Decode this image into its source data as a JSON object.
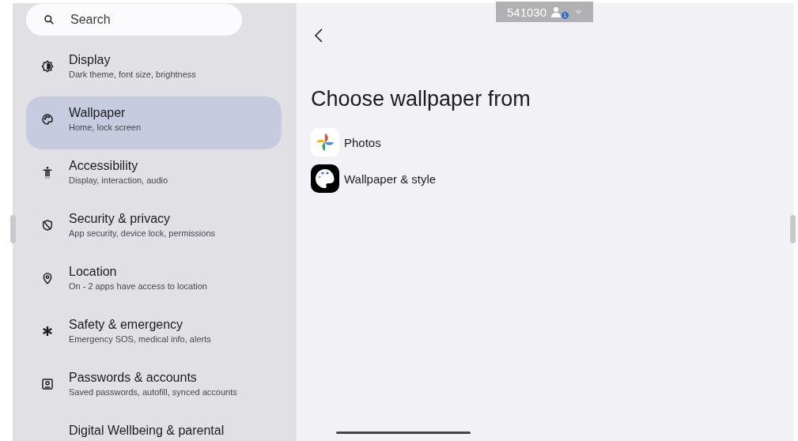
{
  "search": {
    "placeholder": "Search"
  },
  "sidebar": {
    "items": [
      {
        "kind": "display",
        "title": "Display",
        "subtitle": "Dark theme, font size, brightness",
        "selected": false
      },
      {
        "kind": "palette",
        "title": "Wallpaper",
        "subtitle": "Home, lock screen",
        "selected": true
      },
      {
        "kind": "accessibility",
        "title": "Accessibility",
        "subtitle": "Display, interaction, audio",
        "selected": false
      },
      {
        "kind": "shield",
        "title": "Security & privacy",
        "subtitle": "App security, device lock, permissions",
        "selected": false
      },
      {
        "kind": "location",
        "title": "Location",
        "subtitle": "On - 2 apps have access to location",
        "selected": false
      },
      {
        "kind": "asterisk",
        "title": "Safety & emergency",
        "subtitle": "Emergency SOS, medical info, alerts",
        "selected": false
      },
      {
        "kind": "account",
        "title": "Passwords & accounts",
        "subtitle": "Saved passwords, autofill, synced accounts",
        "selected": false
      },
      {
        "kind": "none",
        "title": "Digital Wellbeing & parental",
        "selected": false
      }
    ]
  },
  "session_badge": {
    "label": "541030",
    "count": "1"
  },
  "page": {
    "title": "Choose wallpaper from",
    "options": [
      {
        "kind": "photos",
        "label": "Photos"
      },
      {
        "kind": "style",
        "label": "Wallpaper & style"
      }
    ]
  }
}
